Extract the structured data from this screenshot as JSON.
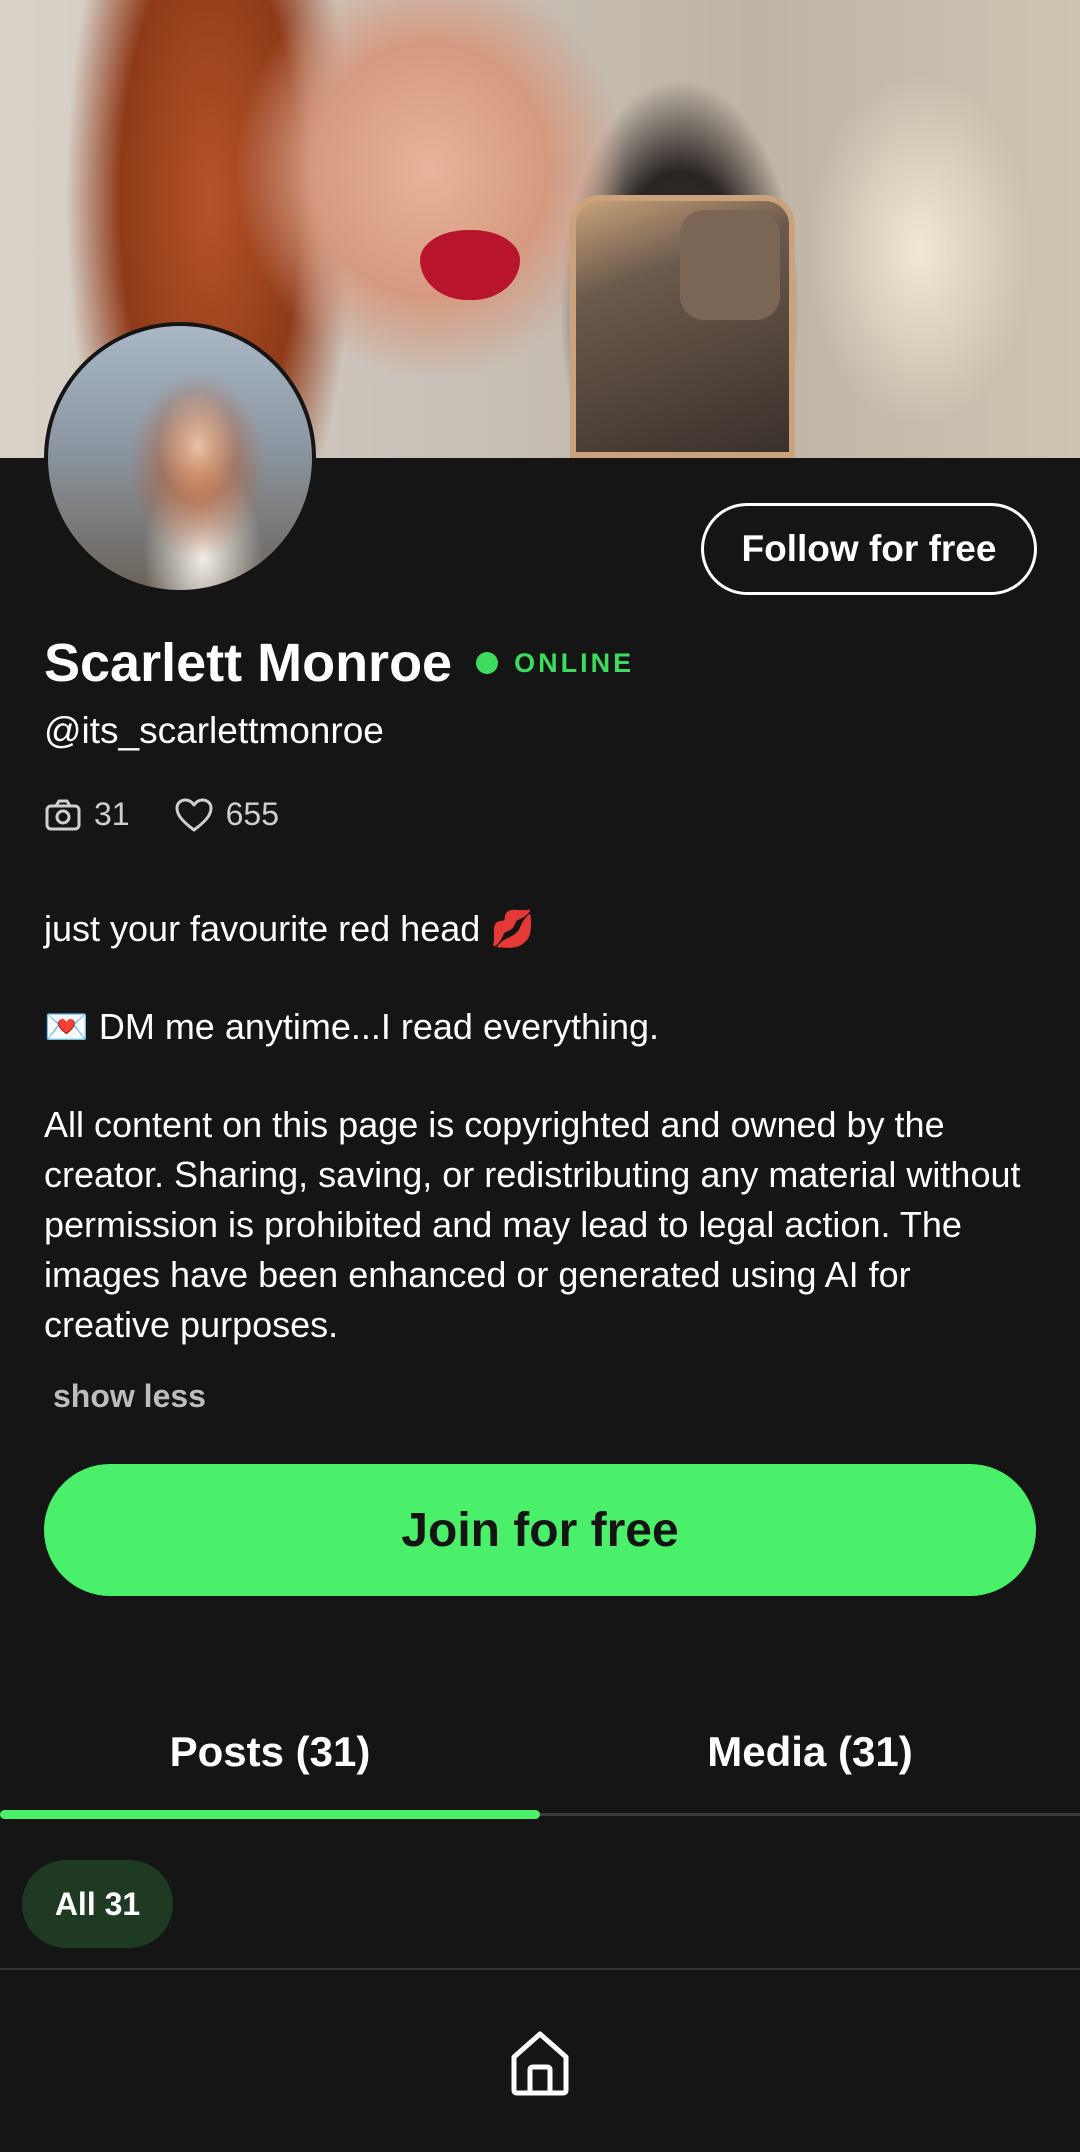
{
  "cover": {
    "image": "cover-photo"
  },
  "profile": {
    "avatar": "profile-avatar",
    "follow_label": "Follow for free",
    "name": "Scarlett Monroe",
    "status": "ONLINE",
    "handle": "@its_scarlettmonroe",
    "stats": {
      "photos_icon": "camera-icon",
      "photos": "31",
      "likes_icon": "heart-icon",
      "likes": "655"
    },
    "bio": {
      "line1": "just your favourite red head 💋",
      "line2": "💌 DM me anytime...I read everything.",
      "line3": "All content on this page is copyrighted and owned by the creator. Sharing, saving, or redistributing any material without permission is prohibited and may lead to legal action. The images have been enhanced or generated using AI for creative purposes."
    },
    "show_less": "show less",
    "join_label": "Join for free"
  },
  "tabs": [
    {
      "label": "Posts (31)",
      "active": true
    },
    {
      "label": "Media (31)",
      "active": false
    }
  ],
  "filter_chip": "All 31",
  "bottom_nav": {
    "icon": "home-icon"
  },
  "colors": {
    "background": "#151515",
    "accent": "#4bf06a",
    "online": "#3ddc5f",
    "chip_bg": "#1e3a23"
  }
}
